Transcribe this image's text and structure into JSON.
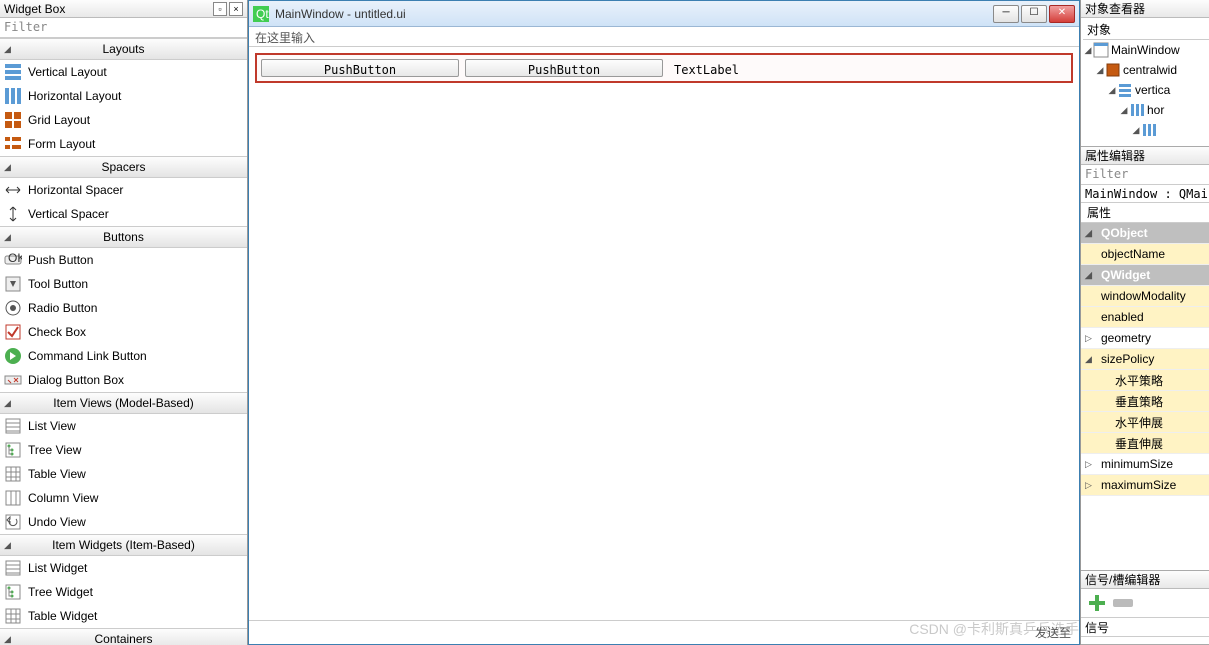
{
  "widgetBox": {
    "title": "Widget Box",
    "filterPlaceholder": "Filter",
    "categories": [
      {
        "name": "Layouts",
        "items": [
          "Vertical Layout",
          "Horizontal Layout",
          "Grid Layout",
          "Form Layout"
        ]
      },
      {
        "name": "Spacers",
        "items": [
          "Horizontal Spacer",
          "Vertical Spacer"
        ]
      },
      {
        "name": "Buttons",
        "items": [
          "Push Button",
          "Tool Button",
          "Radio Button",
          "Check Box",
          "Command Link Button",
          "Dialog Button Box"
        ]
      },
      {
        "name": "Item Views (Model-Based)",
        "items": [
          "List View",
          "Tree View",
          "Table View",
          "Column View",
          "Undo View"
        ]
      },
      {
        "name": "Item Widgets (Item-Based)",
        "items": [
          "List Widget",
          "Tree Widget",
          "Table Widget"
        ]
      },
      {
        "name": "Containers",
        "items": []
      }
    ]
  },
  "designer": {
    "windowTitle": "MainWindow - untitled.ui",
    "typeHere": "在这里输入",
    "button1": "PushButton",
    "button2": "PushButton",
    "label1": "TextLabel",
    "sendTo": "发送至"
  },
  "objectInspector": {
    "title": "对象查看器",
    "colObject": "对象",
    "tree": [
      {
        "name": "MainWindow",
        "indent": 0,
        "icon": "window"
      },
      {
        "name": "centralwid",
        "indent": 1,
        "icon": "widget"
      },
      {
        "name": "vertica",
        "indent": 2,
        "icon": "vlayout"
      },
      {
        "name": "hor",
        "indent": 3,
        "icon": "hlayout"
      },
      {
        "name": "",
        "indent": 4,
        "icon": "hlayout"
      }
    ]
  },
  "propertyEditor": {
    "title": "属性编辑器",
    "filterPlaceholder": "Filter",
    "context": "MainWindow : QMainWin",
    "colProperty": "属性",
    "rows": [
      {
        "label": "QObject",
        "type": "group"
      },
      {
        "label": "objectName",
        "type": "alt"
      },
      {
        "label": "QWidget",
        "type": "group"
      },
      {
        "label": "windowModality",
        "type": "alt"
      },
      {
        "label": "enabled",
        "type": "alt"
      },
      {
        "label": "geometry",
        "type": "plain",
        "expand": "▷"
      },
      {
        "label": "sizePolicy",
        "type": "alt",
        "expand": "◢"
      },
      {
        "label": "水平策略",
        "type": "alt",
        "child": true
      },
      {
        "label": "垂直策略",
        "type": "alt",
        "child": true
      },
      {
        "label": "水平伸展",
        "type": "alt",
        "child": true
      },
      {
        "label": "垂直伸展",
        "type": "alt",
        "child": true
      },
      {
        "label": "minimumSize",
        "type": "plain",
        "expand": "▷"
      },
      {
        "label": "maximumSize",
        "type": "alt",
        "expand": "▷"
      }
    ]
  },
  "signalSlot": {
    "title": "信号/槽编辑器",
    "colSender": "信号"
  },
  "watermark": "CSDN @卡利斯真乒乓选手"
}
